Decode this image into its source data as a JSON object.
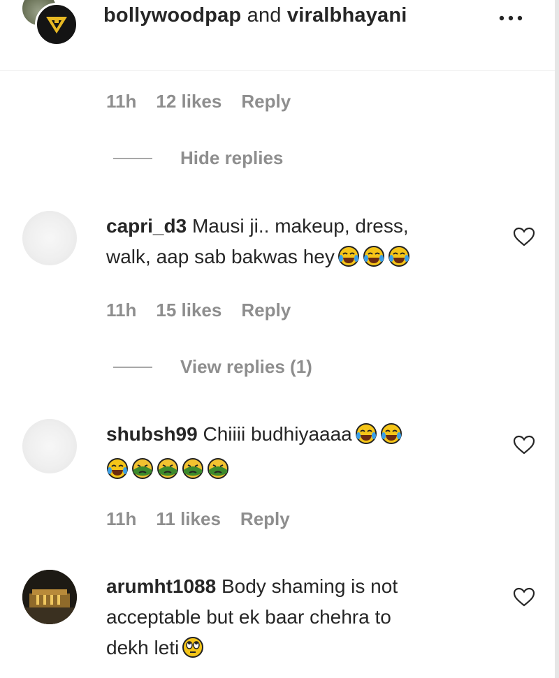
{
  "header": {
    "user1": "bollywoodpap",
    "and": "and",
    "user2": "viralbhayani",
    "more_icon": "more-horizontal-icon"
  },
  "top_meta": {
    "time": "11h",
    "likes": "12 likes",
    "reply": "Reply"
  },
  "hide_replies": "Hide replies",
  "comments": [
    {
      "username": "capri_d3",
      "text_line1": "Mausi ji.. makeup, dress,",
      "text_line2": "walk, aap sab bakwas hey",
      "emojis": [
        "tears-of-joy-emoji",
        "tears-of-joy-emoji",
        "tears-of-joy-emoji"
      ],
      "time": "11h",
      "likes": "15 likes",
      "reply": "Reply",
      "view_replies": "View replies (1)"
    },
    {
      "username": "shubsh99",
      "text_line1": "Chiiii budhiyaaaa",
      "emojis_line1": [
        "tears-of-joy-emoji",
        "tears-of-joy-emoji"
      ],
      "emojis_line2": [
        "tears-of-joy-emoji",
        "nauseated-face-emoji",
        "nauseated-face-emoji",
        "nauseated-face-emoji",
        "nauseated-face-emoji"
      ],
      "time": "11h",
      "likes": "11 likes",
      "reply": "Reply"
    },
    {
      "username": "arumht1088",
      "text_line1": "Body shaming is not",
      "text_line2": "acceptable but ek baar chehra to",
      "text_line3": "dekh leti",
      "emojis": [
        "rolling-eyes-emoji"
      ]
    }
  ],
  "icons": {
    "like": "heart-outline-icon"
  },
  "colors": {
    "text": "#262626",
    "secondary": "#8e8e8e",
    "divider": "#a8a8a8"
  }
}
